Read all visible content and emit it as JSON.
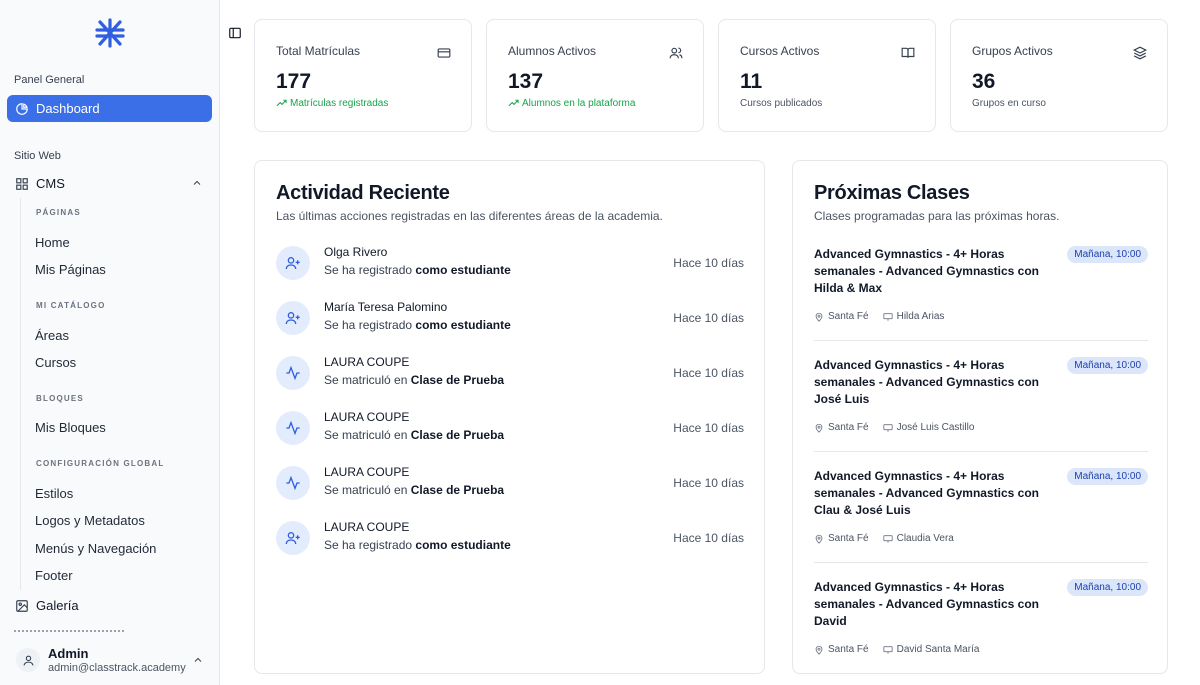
{
  "sidebar": {
    "panel_label": "Panel General",
    "dashboard": "Dashboard",
    "site_label": "Sitio Web",
    "cms": "CMS",
    "groups": [
      {
        "head": "PÁGINAS",
        "items": [
          "Home",
          "Mis Páginas"
        ]
      },
      {
        "head": "MI CATÁLOGO",
        "items": [
          "Áreas",
          "Cursos"
        ]
      },
      {
        "head": "BLOQUES",
        "items": [
          "Mis Bloques"
        ]
      },
      {
        "head": "CONFIGURACIÓN GLOBAL",
        "items": [
          "Estilos",
          "Logos y Metadatos",
          "Menús y Navegación",
          "Footer"
        ]
      }
    ],
    "gallery": "Galería",
    "user": {
      "name": "Admin",
      "email": "admin@classtrack.academy"
    }
  },
  "stats": [
    {
      "title": "Total Matrículas",
      "value": "177",
      "sub": "Matrículas registradas",
      "icon": "credit-card-icon"
    },
    {
      "title": "Alumnos Activos",
      "value": "137",
      "sub": "Alumnos en la plataforma",
      "icon": "users-icon"
    },
    {
      "title": "Cursos Activos",
      "value": "11",
      "sub": "Cursos publicados",
      "icon": "book-icon"
    },
    {
      "title": "Grupos Activos",
      "value": "36",
      "sub": "Grupos en curso",
      "icon": "layers-icon"
    }
  ],
  "activity": {
    "title": "Actividad Reciente",
    "subtitle": "Las últimas acciones registradas en las diferentes áreas de la academia.",
    "items": [
      {
        "name": "Olga Rivero",
        "action": "Se ha registrado",
        "target": "como estudiante",
        "time": "Hace 10 días",
        "icon": "user-plus-icon"
      },
      {
        "name": "María Teresa Palomino",
        "action": "Se ha registrado",
        "target": "como estudiante",
        "time": "Hace 10 días",
        "icon": "user-plus-icon"
      },
      {
        "name": "LAURA COUPE",
        "action": "Se matriculó en",
        "target": "Clase de Prueba",
        "time": "Hace 10 días",
        "icon": "activity-icon"
      },
      {
        "name": "LAURA COUPE",
        "action": "Se matriculó en",
        "target": "Clase de Prueba",
        "time": "Hace 10 días",
        "icon": "activity-icon"
      },
      {
        "name": "LAURA COUPE",
        "action": "Se matriculó en",
        "target": "Clase de Prueba",
        "time": "Hace 10 días",
        "icon": "activity-icon"
      },
      {
        "name": "LAURA COUPE",
        "action": "Se ha registrado",
        "target": "como estudiante",
        "time": "Hace 10 días",
        "icon": "user-plus-icon"
      }
    ]
  },
  "classes": {
    "title": "Próximas Clases",
    "subtitle": "Clases programadas para las próximas horas.",
    "items": [
      {
        "title": "Advanced Gymnastics - 4+ Horas semanales - Advanced Gymnastics con Hilda & Max",
        "badge": "Mañana, 10:00",
        "location": "Santa Fé",
        "teacher": "Hilda Arias"
      },
      {
        "title": "Advanced Gymnastics - 4+ Horas semanales - Advanced Gymnastics con José Luis",
        "badge": "Mañana, 10:00",
        "location": "Santa Fé",
        "teacher": "José Luis Castillo"
      },
      {
        "title": "Advanced Gymnastics - 4+ Horas semanales - Advanced Gymnastics con Clau & José Luis",
        "badge": "Mañana, 10:00",
        "location": "Santa Fé",
        "teacher": "Claudia Vera"
      },
      {
        "title": "Advanced Gymnastics - 4+ Horas semanales - Advanced Gymnastics con David",
        "badge": "Mañana, 10:00",
        "location": "Santa Fé",
        "teacher": "David Santa María"
      }
    ]
  },
  "colors": {
    "accent": "#3b6fe8",
    "success": "#16a34a",
    "badge_bg": "#dbe6fb"
  }
}
